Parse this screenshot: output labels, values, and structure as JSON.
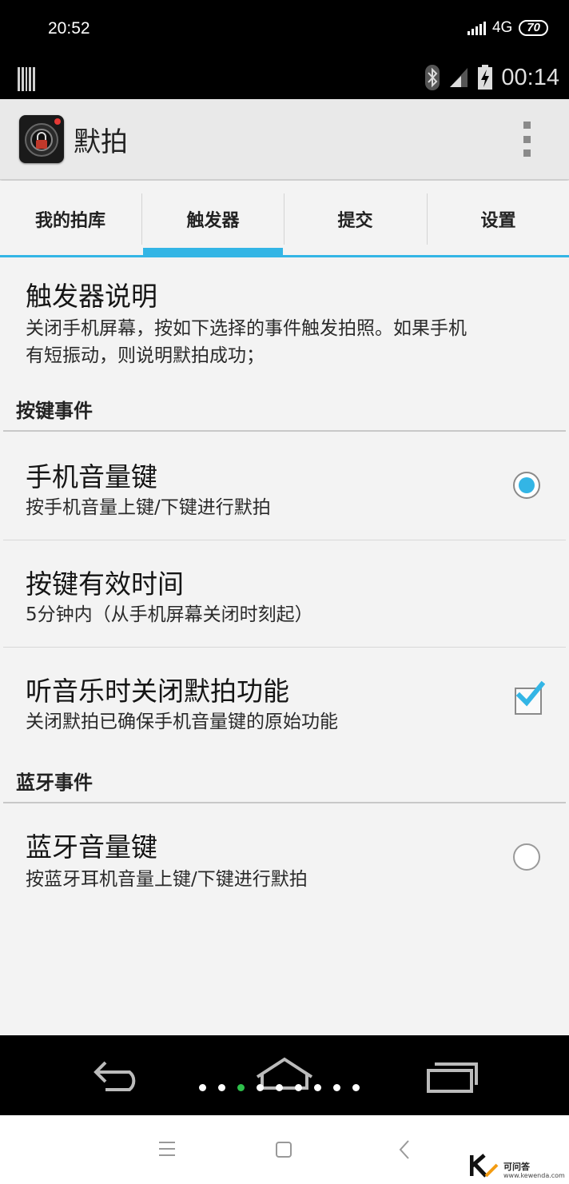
{
  "outer_status": {
    "time": "20:52",
    "network": "4G",
    "battery": "70"
  },
  "inner_status": {
    "time": "00:14"
  },
  "action_bar": {
    "title": "默拍"
  },
  "tabs": [
    {
      "label": "我的拍库"
    },
    {
      "label": "触发器"
    },
    {
      "label": "提交"
    },
    {
      "label": "设置"
    }
  ],
  "content": {
    "intro": {
      "title": "触发器说明",
      "summary_line1": "关闭手机屏幕，按如下选择的事件触发拍照。如果手机",
      "summary_line2": "有短振动，则说明默拍成功；"
    },
    "categories": [
      {
        "label": "按键事件"
      },
      {
        "label": "蓝牙事件"
      }
    ],
    "items": [
      {
        "title": "手机音量键",
        "summary": "按手机音量上键/下键进行默拍",
        "control": "radio",
        "checked": true
      },
      {
        "title": "按键有效时间",
        "summary": "5分钟内（从手机屏幕关闭时刻起）"
      },
      {
        "title": "听音乐时关闭默拍功能",
        "summary": "关闭默拍已确保手机音量键的原始功能",
        "control": "checkbox",
        "checked": true
      },
      {
        "title": "蓝牙音量键",
        "summary": "按蓝牙耳机音量上键/下键进行默拍",
        "control": "radio",
        "checked": false
      }
    ]
  },
  "nav": {
    "page_dots": 9,
    "active_dot": 3
  },
  "watermark": {
    "text": "可问答",
    "url": "www.kewenda.com"
  },
  "colors": {
    "accent": "#33b5e5",
    "page_dot_active": "#2ec04b"
  }
}
